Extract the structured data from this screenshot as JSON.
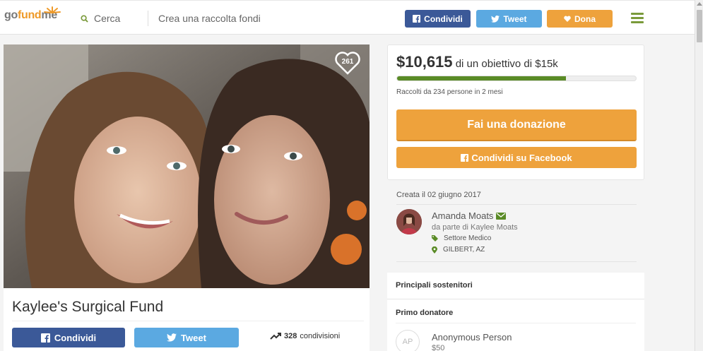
{
  "header": {
    "logo_go": "go",
    "logo_fund": "fund",
    "logo_me": "me",
    "search_label": "Cerca",
    "start_link": "Crea una raccolta fondi",
    "btn_share": "Condividi",
    "btn_tweet": "Tweet",
    "btn_donate": "Dona"
  },
  "photo": {
    "hearts_count": "261"
  },
  "campaign": {
    "title": "Kaylee's Surgical Fund",
    "share_fb": "Condividi",
    "share_tw": "Tweet",
    "shares_count": "328",
    "shares_label": "condivisioni"
  },
  "donation": {
    "raised_amount": "$10,615",
    "goal_text": "di un obiettivo di $15k",
    "progress_fraction": 0.708,
    "raised_by": "Raccolti da 234 persone in 2 mesi",
    "donate_button": "Fai una donazione",
    "fb_share_button": "Condividi su Facebook"
  },
  "organizer": {
    "created": "Creata il 02 giugno 2017",
    "name": "Amanda Moats",
    "on_behalf": "da parte di Kaylee Moats",
    "category": "Settore Medico",
    "location": "GILBERT, AZ"
  },
  "supporters": {
    "heading": "Principali sostenitori",
    "first_donor_label": "Primo donatore",
    "donor_initials": "AP",
    "donor_name": "Anonymous Person",
    "donor_amount": "$50"
  },
  "colors": {
    "facebook": "#3b5998",
    "twitter": "#5ba9e1",
    "donate": "#eea23c",
    "progress": "#5a8b26",
    "menu": "#7a9a3a"
  }
}
